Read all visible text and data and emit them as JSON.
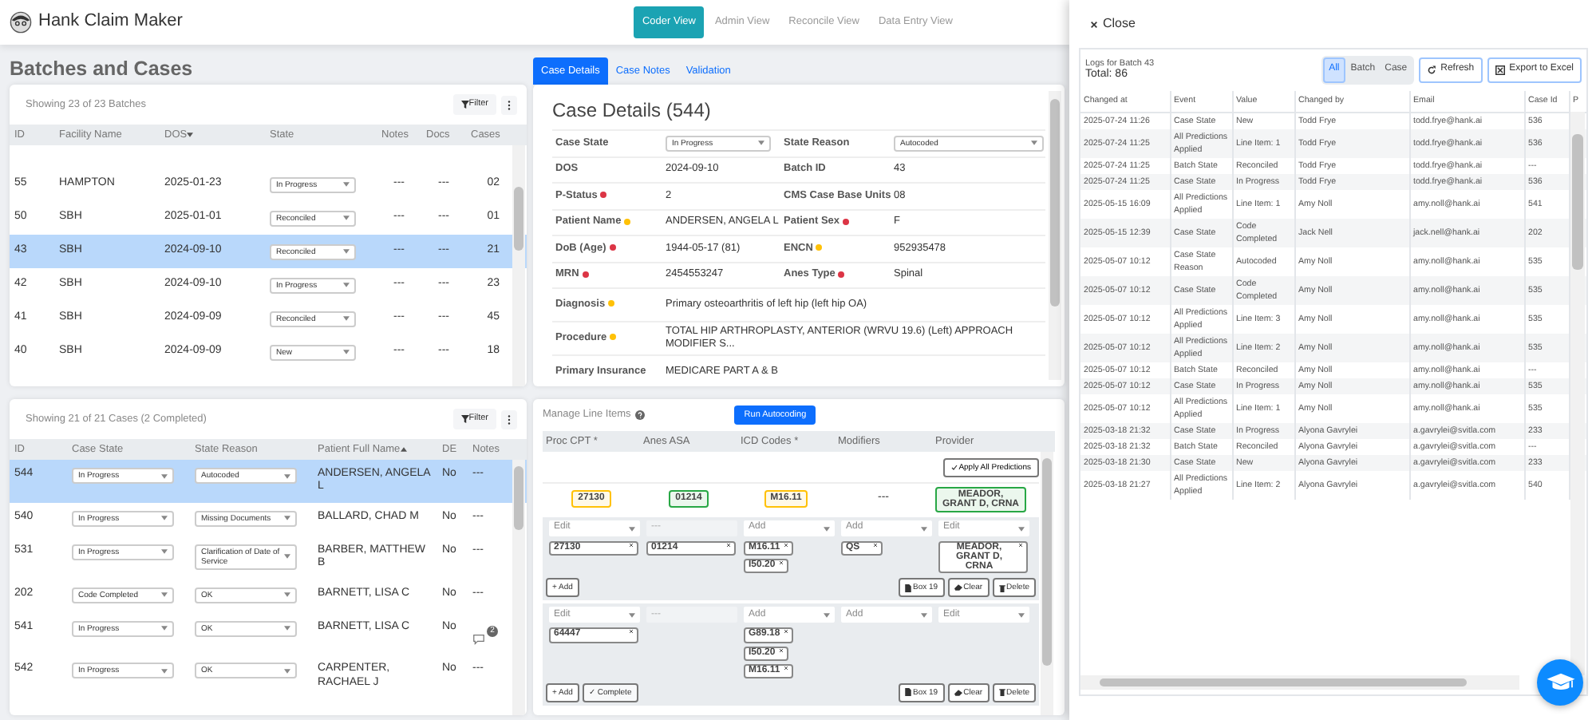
{
  "app": {
    "title": "Hank Claim Maker"
  },
  "nav": [
    {
      "label": "Coder View",
      "selected": true
    },
    {
      "label": "Admin View",
      "selected": false
    },
    {
      "label": "Reconcile View",
      "selected": false
    },
    {
      "label": "Data Entry View",
      "selected": false
    }
  ],
  "page_title": "Batches and Cases",
  "batches": {
    "summary": "Showing 23 of 23 Batches",
    "filter": "Filter",
    "columns": [
      {
        "label": "ID"
      },
      {
        "label": "Facility Name"
      },
      {
        "label": "DOS",
        "sorted_descending": true
      },
      {
        "label": "State"
      },
      {
        "label": "Notes"
      },
      {
        "label": "Docs"
      },
      {
        "label": "Cases"
      }
    ],
    "rows": [
      {
        "id": "55",
        "facility": "HAMPTON",
        "dos": "2025-01-23",
        "state": "In Progress",
        "notes": "---",
        "docs": "---",
        "cases": "02",
        "selected": false
      },
      {
        "id": "50",
        "facility": "SBH",
        "dos": "2025-01-01",
        "state": "Reconciled",
        "notes": "---",
        "docs": "---",
        "cases": "01",
        "selected": false
      },
      {
        "id": "43",
        "facility": "SBH",
        "dos": "2024-09-10",
        "state": "Reconciled",
        "notes": "---",
        "docs": "---",
        "cases": "21",
        "selected": true
      },
      {
        "id": "42",
        "facility": "SBH",
        "dos": "2024-09-10",
        "state": "In Progress",
        "notes": "---",
        "docs": "---",
        "cases": "23",
        "selected": false
      },
      {
        "id": "41",
        "facility": "SBH",
        "dos": "2024-09-09",
        "state": "Reconciled",
        "notes": "---",
        "docs": "---",
        "cases": "45",
        "selected": false
      },
      {
        "id": "40",
        "facility": "SBH",
        "dos": "2024-09-09",
        "state": "New",
        "notes": "---",
        "docs": "---",
        "cases": "18",
        "selected": false
      }
    ]
  },
  "cases": {
    "summary": "Showing 21 of 21 Cases (2 Completed)",
    "filter": "Filter",
    "columns": [
      {
        "label": "ID"
      },
      {
        "label": "Case State"
      },
      {
        "label": "State Reason"
      },
      {
        "label": "Patient Full Name",
        "sorted_ascending": true
      },
      {
        "label": "DE"
      },
      {
        "label": "Notes"
      }
    ],
    "rows": [
      {
        "id": "544",
        "case_state": "In Progress",
        "reason": "Autocoded",
        "patient": "ANDERSEN, ANGELA L",
        "de": "No",
        "notes": {
          "kind": "text",
          "text": "---"
        },
        "selected": true
      },
      {
        "id": "540",
        "case_state": "In Progress",
        "reason": "Missing Documents",
        "patient": "BALLARD, CHAD M",
        "de": "No",
        "notes": {
          "kind": "text",
          "text": "---"
        },
        "selected": false
      },
      {
        "id": "531",
        "case_state": "In Progress",
        "reason": "Clarification of Date of Service",
        "patient": "BARBER, MATTHEW B",
        "de": "No",
        "notes": {
          "kind": "text",
          "text": "---"
        },
        "selected": false
      },
      {
        "id": "202",
        "case_state": "Code Completed",
        "reason": "OK",
        "patient": "BARNETT, LISA C",
        "de": "No",
        "notes": {
          "kind": "text",
          "text": "---"
        },
        "selected": false
      },
      {
        "id": "541",
        "case_state": "In Progress",
        "reason": "OK",
        "patient": "BARNETT, LISA C",
        "de": "No",
        "notes": {
          "kind": "comment",
          "badge": "2"
        },
        "selected": false
      },
      {
        "id": "542",
        "case_state": "In Progress",
        "reason": "OK",
        "patient": "CARPENTER, RACHAEL J",
        "de": "No",
        "notes": {
          "kind": "text",
          "text": "---"
        },
        "selected": false
      }
    ]
  },
  "detail_tabs": [
    {
      "label": "Case Details",
      "selected": true
    },
    {
      "label": "Case Notes",
      "selected": false
    },
    {
      "label": "Validation",
      "selected": false
    }
  ],
  "details": {
    "title": "Case Details (544)",
    "rows": [
      [
        {
          "label": "Case State",
          "kind": "select",
          "value": "In Progress"
        },
        {
          "label": "State Reason",
          "kind": "select",
          "value": "Autocoded"
        }
      ],
      [
        {
          "label": "DOS",
          "kind": "text",
          "value": "2024-09-10"
        },
        {
          "label": "Batch ID",
          "kind": "text",
          "value": "43"
        }
      ],
      [
        {
          "label": "P-Status",
          "kind": "text",
          "value": "2",
          "color": "#dc3545"
        },
        {
          "label": "CMS Case Base Units",
          "kind": "text",
          "value": "08"
        }
      ],
      [
        {
          "label": "Patient Name",
          "kind": "text",
          "value": "ANDERSEN, ANGELA L",
          "color": "#ffc107"
        },
        {
          "label": "Patient Sex",
          "kind": "text",
          "value": "F",
          "color": "#dc3545"
        }
      ],
      [
        {
          "label": "DoB (Age)",
          "kind": "text",
          "value": "1944-05-17 (81)",
          "color": "#dc3545"
        },
        {
          "label": "ENCN",
          "kind": "text",
          "value": "952935478",
          "color": "#ffc107"
        }
      ],
      [
        {
          "label": "MRN",
          "kind": "text",
          "value": "2454553247",
          "color": "#dc3545"
        },
        {
          "label": "Anes Type",
          "kind": "text",
          "value": "Spinal",
          "color": "#dc3545"
        }
      ],
      [
        {
          "label": "Diagnosis",
          "kind": "text",
          "value": "Primary osteoarthritis of left hip (left hip OA)",
          "color": "#ffc107"
        }
      ],
      [
        {
          "label": "Procedure",
          "kind": "text",
          "value": "TOTAL HIP ARTHROPLASTY, ANTERIOR (WRVU 19.6) (Left) APPROACH MODIFIER S...",
          "color": "#ffc107"
        }
      ],
      [
        {
          "label": "Primary Insurance",
          "kind": "text",
          "value": "MEDICARE PART A & B"
        }
      ]
    ]
  },
  "line_items": {
    "title": "Manage Line Items",
    "run_button": "Run Autocoding",
    "columns": [
      "Proc CPT *",
      "Anes ASA",
      "ICD Codes *",
      "Modifiers",
      "Provider"
    ],
    "apply_button": "Apply All Predictions",
    "predictions": [
      {
        "text": "27130",
        "color": "#ffc107"
      },
      {
        "text": "01214",
        "color": "#28a745"
      },
      {
        "text": "M16.11",
        "color": "#ffc107"
      },
      {
        "text": "---"
      },
      {
        "text": "MEADOR, GRANT D, CRNA",
        "color": "#28a745"
      }
    ],
    "items": [
      {
        "selects": [
          {
            "placeholder": "Edit",
            "disabled": false
          },
          {
            "placeholder": "---",
            "disabled": true
          },
          {
            "placeholder": "Add",
            "disabled": false
          },
          {
            "placeholder": "Add",
            "disabled": false
          },
          {
            "placeholder": "Edit",
            "disabled": false
          }
        ],
        "tags": {
          "proc_cpt": [
            "27130"
          ],
          "anes_asa": [
            "01214"
          ],
          "icd_codes": [
            "M16.11",
            "I50.20"
          ],
          "modifiers": [
            "QS"
          ],
          "provider": [
            "MEADOR, GRANT D, CRNA"
          ]
        },
        "left_buttons": [
          {
            "kind": "add",
            "label": "+ Add"
          }
        ],
        "right_buttons": [
          {
            "kind": "box19",
            "label": "Box 19"
          },
          {
            "kind": "clear",
            "label": "Clear"
          },
          {
            "kind": "delete",
            "label": "Delete"
          }
        ]
      },
      {
        "selects": [
          {
            "placeholder": "Edit",
            "disabled": false
          },
          {
            "placeholder": "---",
            "disabled": true
          },
          {
            "placeholder": "Add",
            "disabled": false
          },
          {
            "placeholder": "Add",
            "disabled": false
          },
          {
            "placeholder": "Edit",
            "disabled": false
          }
        ],
        "tags": {
          "proc_cpt": [
            "64447"
          ],
          "icd_codes": [
            "G89.18",
            "I50.20",
            "M16.11"
          ]
        },
        "left_buttons": [
          {
            "kind": "add",
            "label": "+ Add"
          },
          {
            "kind": "complete",
            "label": "✓ Complete"
          }
        ],
        "right_buttons": [
          {
            "kind": "box19",
            "label": "Box 19"
          },
          {
            "kind": "clear",
            "label": "Clear"
          },
          {
            "kind": "delete",
            "label": "Delete"
          }
        ]
      }
    ]
  },
  "logs": {
    "close": "Close",
    "title": "Logs for Batch 43",
    "total": "Total: 86",
    "filters": [
      {
        "label": "All",
        "selected": true
      },
      {
        "label": "Batch",
        "selected": false
      },
      {
        "label": "Case",
        "selected": false
      }
    ],
    "refresh": "Refresh",
    "export": "Export to Excel",
    "columns": [
      "Changed at",
      "Event",
      "Value",
      "Changed by",
      "Email",
      "Case Id",
      "P"
    ],
    "rows": [
      [
        "2025-07-24 11:26",
        "Case State",
        "New",
        "Todd Frye",
        "todd.frye@hank.ai",
        "536"
      ],
      [
        "2025-07-24 11:25",
        "All Predictions Applied",
        "Line Item: 1",
        "Todd Frye",
        "todd.frye@hank.ai",
        "536"
      ],
      [
        "2025-07-24 11:25",
        "Batch State",
        "Reconciled",
        "Todd Frye",
        "todd.frye@hank.ai",
        "---"
      ],
      [
        "2025-07-24 11:25",
        "Case State",
        "In Progress",
        "Todd Frye",
        "todd.frye@hank.ai",
        "536"
      ],
      [
        "2025-05-15 16:09",
        "All Predictions Applied",
        "Line Item: 1",
        "Amy Noll",
        "amy.noll@hank.ai",
        "541"
      ],
      [
        "2025-05-15 12:39",
        "Case State",
        "Code Completed",
        "Jack Nell",
        "jack.nell@hank.ai",
        "202"
      ],
      [
        "2025-05-07 10:12",
        "Case State Reason",
        "Autocoded",
        "Amy Noll",
        "amy.noll@hank.ai",
        "535"
      ],
      [
        "2025-05-07 10:12",
        "Case State",
        "Code Completed",
        "Amy Noll",
        "amy.noll@hank.ai",
        "535"
      ],
      [
        "2025-05-07 10:12",
        "All Predictions Applied",
        "Line Item: 3",
        "Amy Noll",
        "amy.noll@hank.ai",
        "535"
      ],
      [
        "2025-05-07 10:12",
        "All Predictions Applied",
        "Line Item: 2",
        "Amy Noll",
        "amy.noll@hank.ai",
        "535"
      ],
      [
        "2025-05-07 10:12",
        "Batch State",
        "Reconciled",
        "Amy Noll",
        "amy.noll@hank.ai",
        "---"
      ],
      [
        "2025-05-07 10:12",
        "Case State",
        "In Progress",
        "Amy Noll",
        "amy.noll@hank.ai",
        "535"
      ],
      [
        "2025-05-07 10:12",
        "All Predictions Applied",
        "Line Item: 1",
        "Amy Noll",
        "amy.noll@hank.ai",
        "535"
      ],
      [
        "2025-03-18 21:32",
        "Case State",
        "In Progress",
        "Alyona Gavrylei",
        "a.gavrylei@svitla.com",
        "233"
      ],
      [
        "2025-03-18 21:32",
        "Batch State",
        "Reconciled",
        "Alyona Gavrylei",
        "a.gavrylei@svitla.com",
        "---"
      ],
      [
        "2025-03-18 21:30",
        "Case State",
        "New",
        "Alyona Gavrylei",
        "a.gavrylei@svitla.com",
        "233"
      ],
      [
        "2025-03-18 21:27",
        "All Predictions Applied",
        "Line Item: 2",
        "Alyona Gavrylei",
        "a.gavrylei@svitla.com",
        "540"
      ]
    ]
  }
}
